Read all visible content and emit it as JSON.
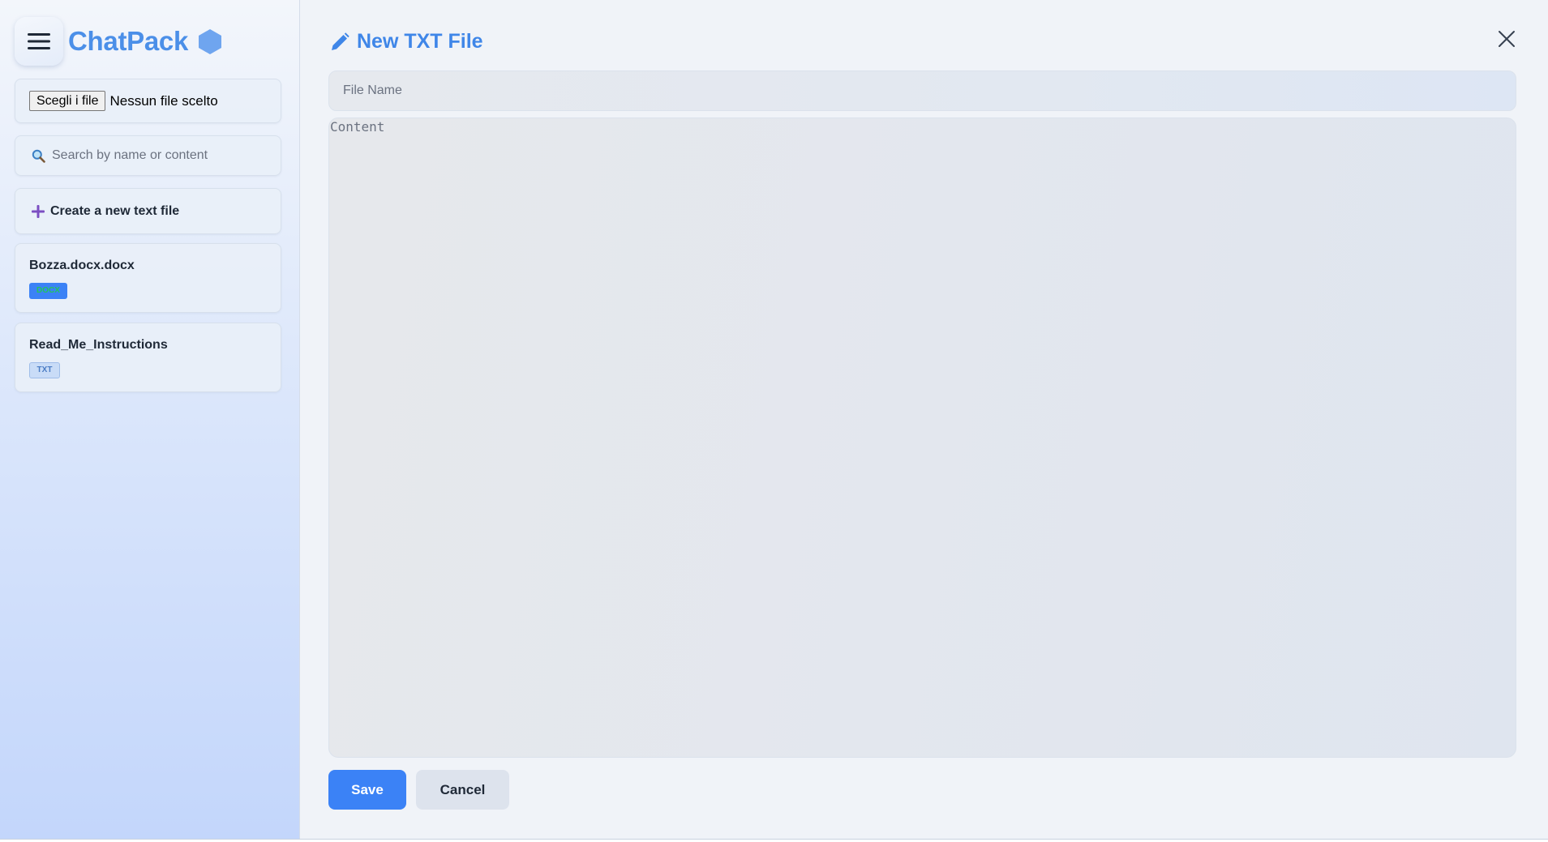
{
  "app": {
    "name": "ChatPack"
  },
  "sidebar": {
    "file_input": {
      "button_label": "Scegli i file",
      "status": "Nessun file scelto"
    },
    "search": {
      "placeholder": "Search by name or content",
      "value": ""
    },
    "create_label": "Create a new text file",
    "files": [
      {
        "name": "Bozza.docx.docx",
        "badge": "DOCX"
      },
      {
        "name": "Read_Me_Instructions",
        "badge": "TXT"
      }
    ]
  },
  "editor": {
    "title": "New TXT File",
    "file_name_placeholder": "File Name",
    "content_placeholder": "Content",
    "save_label": "Save",
    "cancel_label": "Cancel"
  },
  "colors": {
    "accent": "#3b82f6",
    "brand": "#4b8fe8",
    "docx_badge_bg": "#3b82f6",
    "docx_badge_text": "#22c55e",
    "txt_badge_bg": "#c9dcf7"
  },
  "icons": {
    "menu": "hamburger-icon",
    "brand": "hexagon-icon",
    "search": "magnifier-icon",
    "create": "plus-icon",
    "title": "pencil-icon",
    "close": "close-icon"
  }
}
